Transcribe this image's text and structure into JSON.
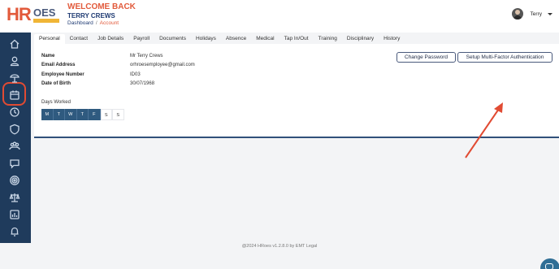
{
  "header": {
    "logo_hr": "HR",
    "logo_oes": "OES",
    "welcome": "WELCOME BACK",
    "username": "TERRY CREWS",
    "breadcrumb": {
      "root": "Dashboard",
      "separator": "/",
      "current": "Account"
    },
    "user_menu": {
      "name": "Terry"
    }
  },
  "sidebar": {
    "items": [
      {
        "icon": "home-icon"
      },
      {
        "icon": "user-icon",
        "highlighted": true
      },
      {
        "icon": "sun-umbrella-icon"
      },
      {
        "icon": "calendar-icon"
      },
      {
        "icon": "clock-icon"
      },
      {
        "icon": "shield-icon"
      },
      {
        "icon": "team-icon"
      },
      {
        "icon": "chat-icon"
      },
      {
        "icon": "target-icon"
      },
      {
        "icon": "scales-icon"
      },
      {
        "icon": "chart-icon"
      },
      {
        "icon": "bell-icon"
      }
    ]
  },
  "tabs": [
    "Personal",
    "Contact",
    "Job Details",
    "Payroll",
    "Documents",
    "Holidays",
    "Absence",
    "Medical",
    "Tap In/Out",
    "Training",
    "Disciplinary",
    "History"
  ],
  "active_tab": "Personal",
  "profile": {
    "fields": [
      {
        "label": "Name",
        "value": "Mr Terry Crews"
      },
      {
        "label": "Email Address",
        "value": "orhroesemployee@gmail.com"
      },
      {
        "label": "Employee Number",
        "value": "ID03"
      },
      {
        "label": "Date of Birth",
        "value": "30/07/1968"
      }
    ],
    "days_title": "Days Worked",
    "days": [
      {
        "label": "M",
        "worked": true
      },
      {
        "label": "T",
        "worked": true
      },
      {
        "label": "W",
        "worked": true
      },
      {
        "label": "T",
        "worked": true
      },
      {
        "label": "F",
        "worked": true
      },
      {
        "label": "S",
        "worked": false
      },
      {
        "label": "S",
        "worked": false
      }
    ]
  },
  "buttons": {
    "change_password": "Change Password",
    "setup_mfa": "Setup Multi-Factor Authentication"
  },
  "footer": {
    "copyright": "@2024 HRoes v1.2.8.0 by EMT Legal"
  },
  "colors": {
    "brand_orange": "#e25a3b",
    "navy": "#1f3b5c",
    "annotation_red": "#e14b33"
  }
}
